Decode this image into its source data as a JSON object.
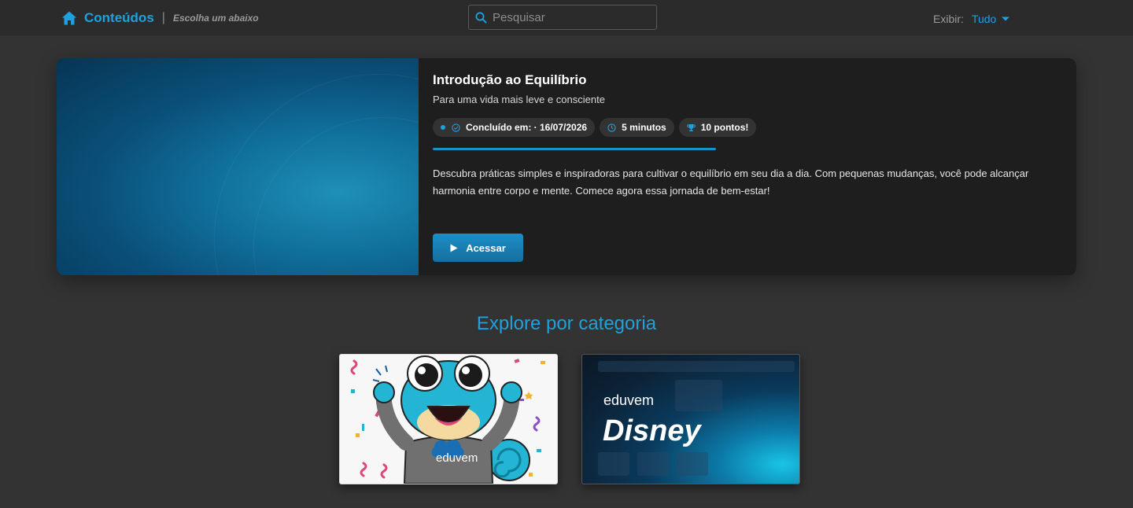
{
  "header": {
    "title": "Conteúdos",
    "separator": "|",
    "subtitle": "Escolha um abaixo",
    "search_placeholder": "Pesquisar",
    "filter_label": "Exibir:",
    "filter_value": "Tudo"
  },
  "hero": {
    "title": "Introdução ao Equilíbrio",
    "subtitle": "Para uma vida mais leve e consciente",
    "chips": {
      "completed": "Concluído em: · 16/07/2026",
      "duration": "5 minutos",
      "points": "10 pontos!"
    },
    "progress": 1.0,
    "description": "Descubra práticas simples e inspiradoras para cultivar o equilíbrio em seu dia a dia. Com pequenas mudanças, você pode alcançar harmonia entre corpo e mente. Comece agora essa jornada de bem-estar!",
    "button_label": "Acessar"
  },
  "categories": {
    "title": "Explore por categoria",
    "items": [
      {
        "brand": "eduvem",
        "title": ""
      },
      {
        "brand": "eduvem",
        "title": "Disney"
      }
    ]
  },
  "colors": {
    "accent": "#1ea1dc",
    "background": "#333333",
    "topbar": "#2b2b2b",
    "card": "#1e1e1e"
  }
}
